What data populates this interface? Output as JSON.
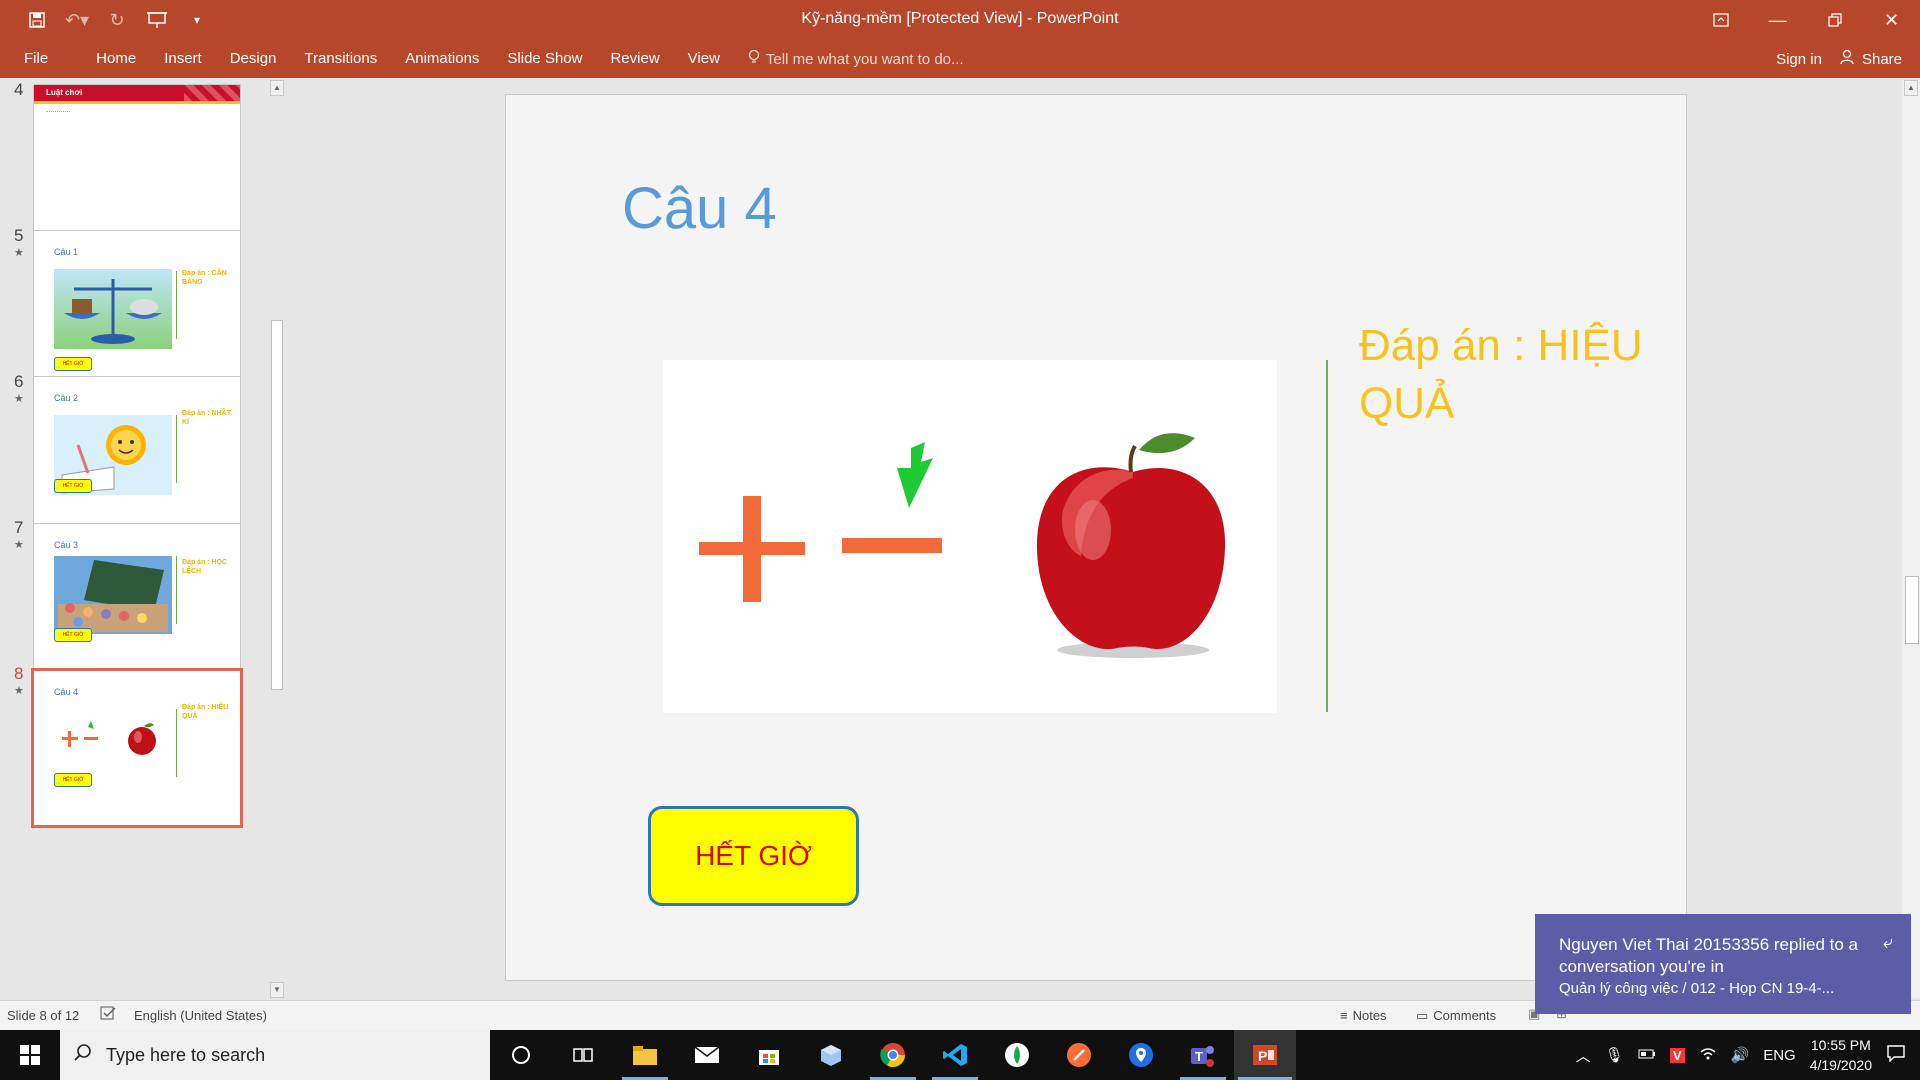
{
  "window": {
    "title": "Kỹ-năng-mềm [Protected View] - PowerPoint",
    "minimize_icon": "minimize-icon",
    "restore_icon": "restore-icon",
    "close_icon": "close-icon"
  },
  "ribbon": {
    "file": "File",
    "tabs": [
      "Home",
      "Insert",
      "Design",
      "Transitions",
      "Animations",
      "Slide Show",
      "Review",
      "View"
    ],
    "tell_me": "Tell me what you want to do...",
    "sign_in": "Sign in",
    "share": "Share"
  },
  "thumbnails": [
    {
      "num": "4",
      "title": "Luật chơi",
      "answer": "",
      "selected": false
    },
    {
      "num": "5",
      "title": "Câu 1",
      "answer": "Đáp án : CÂN BẰNG",
      "selected": false
    },
    {
      "num": "6",
      "title": "Câu 2",
      "answer": "Đáp án : NHẬT KÍ",
      "selected": false
    },
    {
      "num": "7",
      "title": "Câu 3",
      "answer": "Đáp án : HỌC LỆCH",
      "selected": false
    },
    {
      "num": "8",
      "title": "Câu 4",
      "answer": "Đáp án : HIỆU QUẢ",
      "selected": true
    }
  ],
  "thumb_button": "HẾT GIỜ",
  "slide": {
    "title": "Câu 4",
    "answer": "Đáp án : HIỆU QUẢ",
    "button": "HẾT GIỜ"
  },
  "status": {
    "slide_of": "Slide 8 of 12",
    "language": "English (United States)",
    "notes": "Notes",
    "comments": "Comments"
  },
  "taskbar": {
    "search_placeholder": "Type here to search",
    "lang": "ENG",
    "time": "10:55 PM",
    "date": "4/19/2020"
  },
  "toast": {
    "message": "Nguyen Viet Thai 20153356 replied to a conversation you're in",
    "detail": "Quản lý công việc / 012 - Họp CN 19-4-..."
  },
  "colors": {
    "accent": "#b7472a",
    "title_blue": "#5b9bd5",
    "answer_yellow": "#f7c21b",
    "button_yellow": "#ffff00",
    "toast_purple": "#5b5ea6"
  }
}
